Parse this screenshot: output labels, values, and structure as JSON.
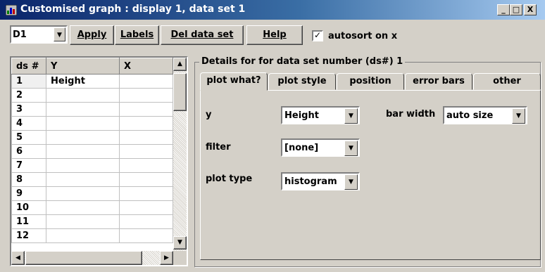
{
  "window": {
    "title": "Customised graph : display 1, data set 1",
    "minimize": "_",
    "maximize": "□",
    "close": "X"
  },
  "toolbar": {
    "display_value": "D1",
    "apply_label": "Apply",
    "labels_label": "Labels",
    "del_label": "Del data set",
    "help_label": "Help",
    "autosort_label": "autosort on x",
    "autosort_checked": true
  },
  "grid": {
    "headers": [
      "ds #",
      "Y",
      "X"
    ],
    "rows": [
      [
        "1",
        "Height",
        ""
      ],
      [
        "2",
        "",
        ""
      ],
      [
        "3",
        "",
        ""
      ],
      [
        "4",
        "",
        ""
      ],
      [
        "5",
        "",
        ""
      ],
      [
        "6",
        "",
        ""
      ],
      [
        "7",
        "",
        ""
      ],
      [
        "8",
        "",
        ""
      ],
      [
        "9",
        "",
        ""
      ],
      [
        "10",
        "",
        ""
      ],
      [
        "11",
        "",
        ""
      ],
      [
        "12",
        "",
        ""
      ]
    ]
  },
  "details": {
    "title": "Details for for data set number (ds#) 1",
    "tabs": [
      "plot what?",
      "plot style",
      "position",
      "error bars",
      "other"
    ],
    "active_tab": "plot what?",
    "y_label": "y",
    "y_value": "Height",
    "filter_label": "filter",
    "filter_value": "[none]",
    "plot_type_label": "plot type",
    "plot_type_value": "histogram",
    "bar_width_label": "bar width",
    "bar_width_value": "auto size"
  }
}
